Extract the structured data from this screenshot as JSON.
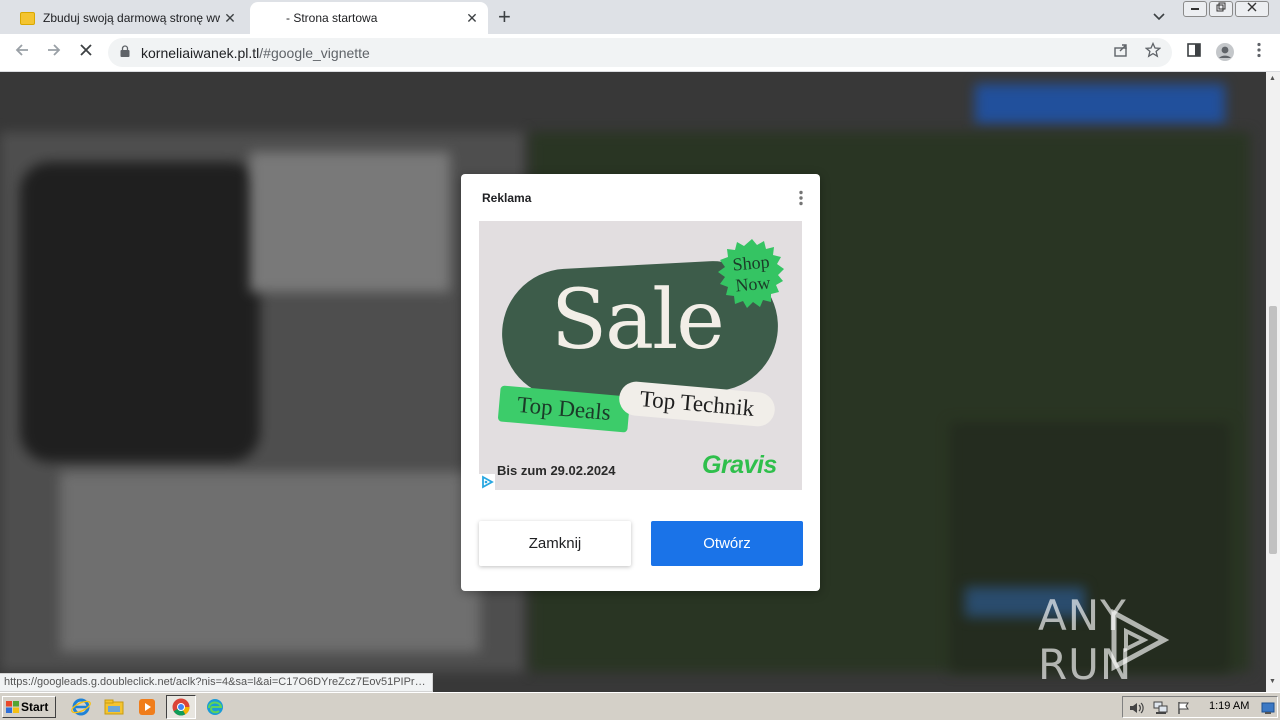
{
  "browser": {
    "tabs": [
      {
        "title": "Zbuduj swoją darmową stronę www",
        "active": false
      },
      {
        "title": "- Strona startowa",
        "active": true
      }
    ],
    "new_tab": "+",
    "tab_close": "✕",
    "url_host": "korneliaiwanek.pl.tl",
    "url_path": "/#google_vignette"
  },
  "dialog": {
    "label": "Reklama",
    "ad": {
      "headline": "Sale",
      "badge_line1": "Shop",
      "badge_line2": "Now",
      "tag1": "Top Deals",
      "tag2": "Top Technik",
      "date": "Bis zum 29.02.2024",
      "brand": "Gravis"
    },
    "close_button": "Zamknij",
    "open_button": "Otwórz"
  },
  "status_url": "https://googleads.g.doubleclick.net/aclk?nis=4&sa=l&ai=C17O6DYreZcz7Eov51PIPr…",
  "watermark": "ANY RUN",
  "taskbar": {
    "start_label": "Start",
    "clock": "1:19 AM"
  },
  "colors": {
    "primary_button": "#1a73e8",
    "ad_green": "#3d5c4a",
    "brand_green": "#2fbf4c",
    "badge_green": "#3ccc6a"
  }
}
